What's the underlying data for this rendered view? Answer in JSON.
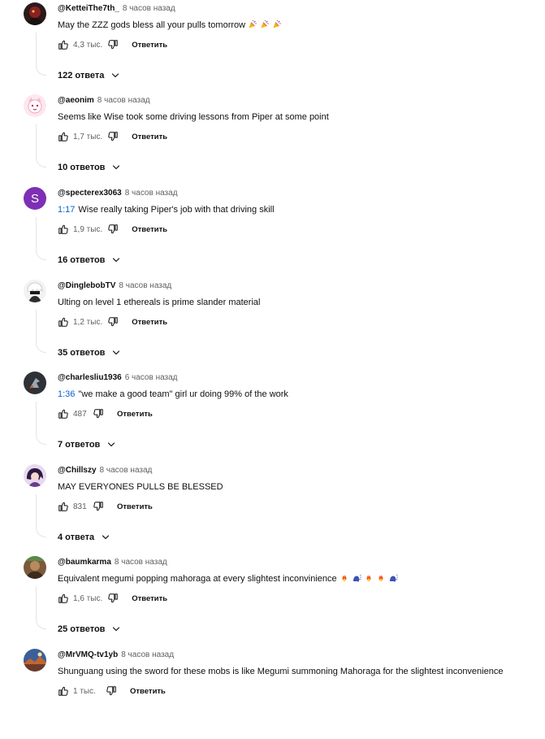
{
  "colors": {
    "link": "#065fd4",
    "meta": "#606060",
    "text": "#0f0f0f"
  },
  "comments": [
    {
      "author": "@KetteiThe7th_",
      "time": "8 часов назад",
      "timestamp": "",
      "text": "May the ZZZ gods bless all your pulls tomorrow",
      "emojis": [
        "party-popper",
        "party-popper",
        "party-popper"
      ],
      "likes": "4,3 тыс.",
      "reply_label": "Ответить",
      "replies": "122 ответа",
      "avatar": "dark-character-avatar"
    },
    {
      "author": "@aeonim",
      "time": "8 часов назад",
      "timestamp": "",
      "text": "Seems like Wise took some driving lessons from Piper at some point",
      "emojis": [],
      "likes": "1,7 тыс.",
      "reply_label": "Ответить",
      "replies": "10 ответов",
      "avatar": "pink-cat-avatar"
    },
    {
      "author": "@specterex3063",
      "time": "8 часов назад",
      "timestamp": "1:17",
      "text": "Wise really taking Piper's job with that driving skill",
      "emojis": [],
      "likes": "1,9 тыс.",
      "reply_label": "Ответить",
      "replies": "16 ответов",
      "avatar": "letter-avatar",
      "avatar_letter": "S",
      "avatar_color": "#7e2fb5"
    },
    {
      "author": "@DinglebobTV",
      "time": "8 часов назад",
      "timestamp": "",
      "text": "Ulting on level 1 ethereals is prime slander material",
      "emojis": [],
      "likes": "1,2 тыс.",
      "reply_label": "Ответить",
      "replies": "35 ответов",
      "avatar": "white-hair-character-avatar"
    },
    {
      "author": "@charlesliu1936",
      "time": "6 часов назад",
      "timestamp": "1:36",
      "text": "\"we make a good team\" girl ur doing 99% of the work",
      "emojis": [],
      "likes": "487",
      "reply_label": "Ответить",
      "replies": "7 ответов",
      "avatar": "dark-logo-avatar"
    },
    {
      "author": "@Chillszy",
      "time": "8 часов назад",
      "timestamp": "",
      "text": "MAY EVERYONES PULLS BE BLESSED",
      "emojis": [],
      "likes": "831",
      "reply_label": "Ответить",
      "replies": "4 ответа",
      "avatar": "purple-character-avatar"
    },
    {
      "author": "@baumkarma",
      "time": "8 часов назад",
      "timestamp": "",
      "text": "Equivalent megumi popping mahoraga at every slightest inconvinience",
      "emojis": [
        "fire",
        "speaking-head",
        "fire",
        "fire",
        "speaking-head"
      ],
      "likes": "1,6 тыс.",
      "reply_label": "Ответить",
      "replies": "25 ответов",
      "avatar": "photo-avatar"
    },
    {
      "author": "@MrVMQ-tv1yb",
      "time": "8 часов назад",
      "timestamp": "",
      "text": "Shunguang using the sword for these mobs is like Megumi summoning Mahoraga for the slightest inconvenience",
      "emojis": [],
      "likes": "1 тыс.",
      "reply_label": "Ответить",
      "replies": "",
      "avatar": "landscape-avatar"
    }
  ]
}
